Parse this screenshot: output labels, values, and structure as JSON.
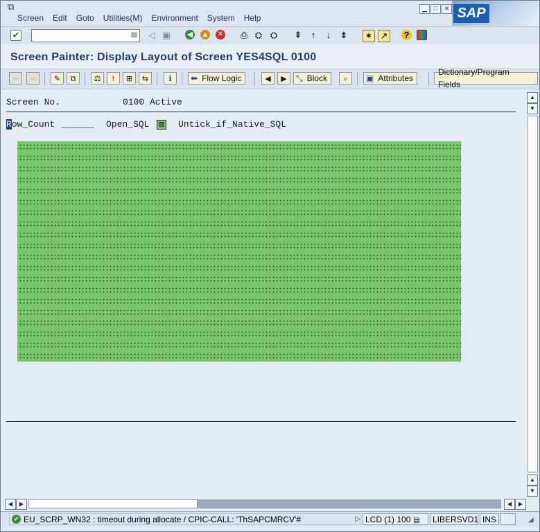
{
  "menubar": {
    "items": [
      "Screen",
      "Edit",
      "Goto",
      "Utilities(M)",
      "Environment",
      "System",
      "Help"
    ],
    "logo": "SAP",
    "window_controls": [
      "minimize-icon",
      "maximize-icon",
      "close-icon"
    ]
  },
  "toolbar": {
    "command_value": "",
    "icons": [
      "enter-icon",
      "back-icon",
      "save-icon",
      "back-icon",
      "exit-icon",
      "cancel-icon",
      "print-icon",
      "find-icon",
      "find-next-icon",
      "first-page-icon",
      "previous-page-icon",
      "next-page-icon",
      "last-page-icon",
      "new-session-icon",
      "shortcut-icon",
      "help-icon",
      "layout-icon"
    ]
  },
  "title": "Screen Painter: Display Layout of Screen YES4SQL 0100",
  "app_toolbar": {
    "flow_logic": "Flow Logic",
    "block": "Block",
    "attributes": "Attributes",
    "dict_fields": "Dictionary/Program Fields"
  },
  "work": {
    "screen_no_label": "Screen No.",
    "screen_no_value": "0100 Active",
    "cursor_char": "R",
    "row_count_label": "ow_Count",
    "row_count_value": "______",
    "open_sql_label": "Open_SQL",
    "checkbox_mark": "⊠",
    "native_label": "Untick_if_Native_SQL",
    "grid_rows": 20
  },
  "statusbar": {
    "message": "EU_SCRP_WN32 : timeout during allocate / CPIC-CALL: 'ThSAPCMRCV'#",
    "system": "LCD (1) 100",
    "server": "LIBERSVD1",
    "mode": "INS"
  },
  "colors": {
    "grid_green": "#78c56c",
    "title_text": "#233e6b",
    "button_face": "#f6f0d6"
  }
}
